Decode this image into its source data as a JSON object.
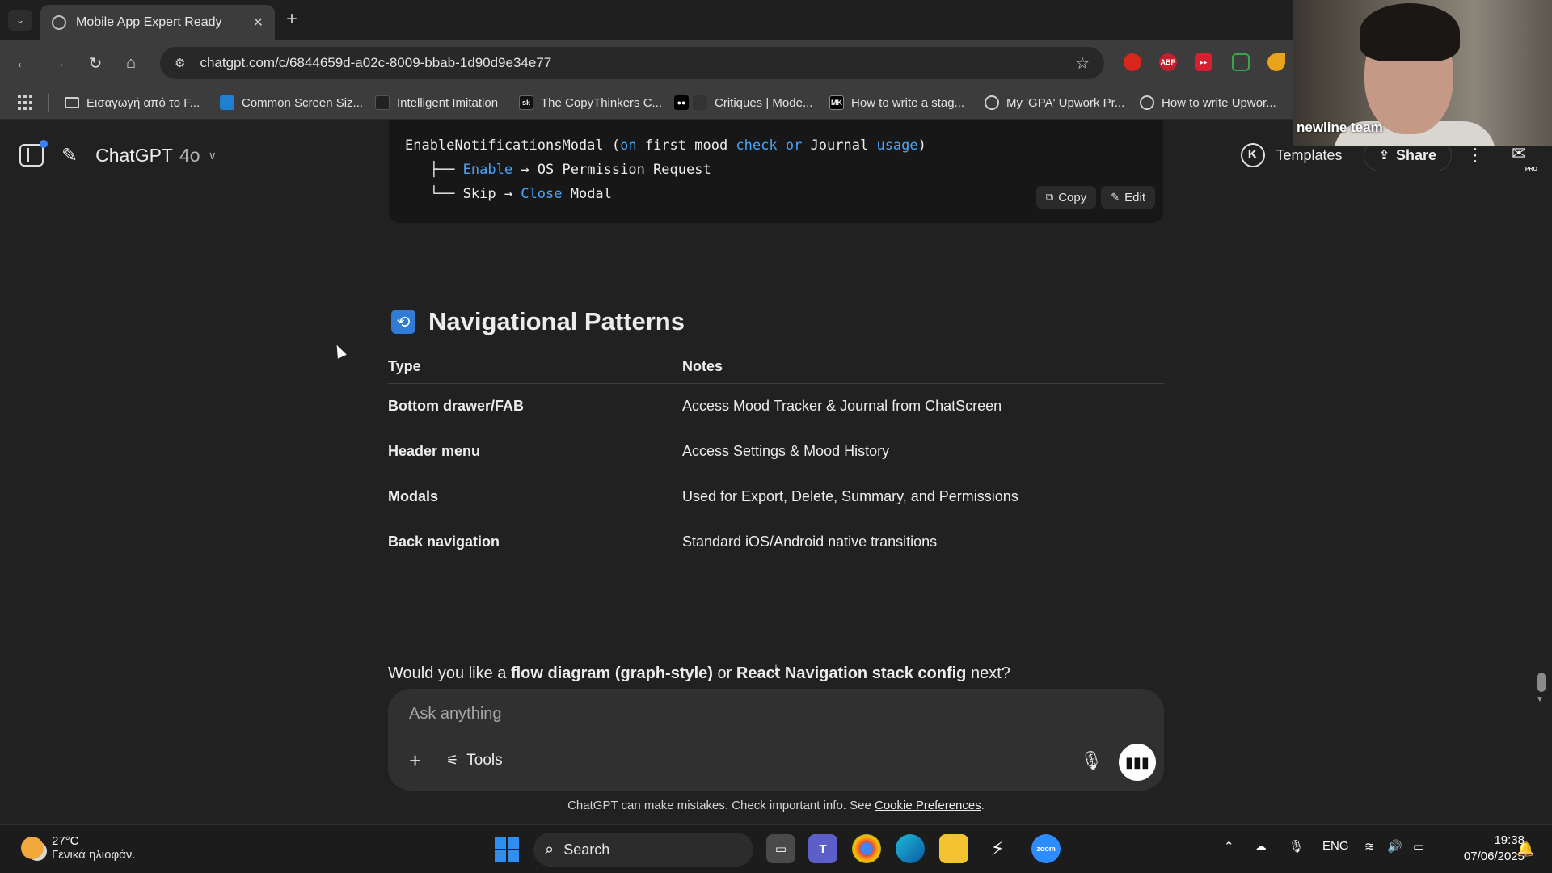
{
  "browser": {
    "tab_title": "Mobile App Expert Ready",
    "url": "chatgpt.com/c/6844659d-a02c-8009-bbab-1d90d9e34e77",
    "bookmarks": [
      {
        "label": "Εισαγωγή από το F...",
        "icon": "folder-icon",
        "color": "#3c3c3c"
      },
      {
        "label": "Common Screen Siz...",
        "icon": "site-icon",
        "color": "#1f7fd1"
      },
      {
        "label": "Intelligent Imitation",
        "icon": "site-icon",
        "color": "#222222"
      },
      {
        "label": "The CopyThinkers C...",
        "icon": "sk-icon",
        "color": "#111111"
      },
      {
        "label": "Critiques | Mode...",
        "icon": "medium-icon",
        "color": "#000000"
      },
      {
        "label": "How to write a stag...",
        "icon": "mk-icon",
        "color": "#000000"
      },
      {
        "label": "My 'GPA' Upwork Pr...",
        "icon": "site-icon",
        "color": "#6b6b6b"
      },
      {
        "label": "How to write Upwor...",
        "icon": "site-icon",
        "color": "#6b6b6b"
      }
    ]
  },
  "header": {
    "model_name": "ChatGPT",
    "model_version": "4o",
    "templates_label": "Templates",
    "k_badge": "K",
    "share_label": "Share",
    "pro_label": "PRO"
  },
  "code": {
    "line1_a": "EnableNotificationsModal (",
    "line1_on": "on",
    "line1_b": " first mood ",
    "line1_check": "check",
    "line1_or": " or",
    "line1_c": " Journal ",
    "line1_usage": "usage",
    "line1_d": ")",
    "line2_a": "   ├── ",
    "line2_enable": "Enable",
    "line2_b": " → OS Permission Request",
    "line3_a": "   └── Skip → ",
    "line3_close": "Close",
    "line3_b": " Modal",
    "copy_label": "Copy",
    "edit_label": "Edit"
  },
  "section": {
    "title": "Navigational Patterns",
    "icon": "repeat-icon"
  },
  "table": {
    "headers": [
      "Type",
      "Notes"
    ],
    "rows": [
      [
        "Bottom drawer/FAB",
        "Access Mood Tracker & Journal from ChatScreen"
      ],
      [
        "Header menu",
        "Access Settings & Mood History"
      ],
      [
        "Modals",
        "Used for Export, Delete, Summary, and Permissions"
      ],
      [
        "Back navigation",
        "Standard iOS/Android native transitions"
      ]
    ]
  },
  "followup": {
    "prefix": "Would you like a ",
    "bold1": "flow diagram (graph-style)",
    "middle": " or ",
    "bold2": "React Navigation stack config",
    "suffix": " next?"
  },
  "composer": {
    "placeholder": "Ask anything",
    "tools_label": "Tools"
  },
  "disclaimer": {
    "text": "ChatGPT can make mistakes. Check important info. See ",
    "link": "Cookie Preferences",
    "end": "."
  },
  "webcam": {
    "label": "newline team"
  },
  "taskbar": {
    "temperature": "27°C",
    "weather": "Γενικά ηλιοφάν.",
    "search_label": "Search",
    "language": "ENG",
    "time": "19:38",
    "date": "07/06/2025"
  }
}
